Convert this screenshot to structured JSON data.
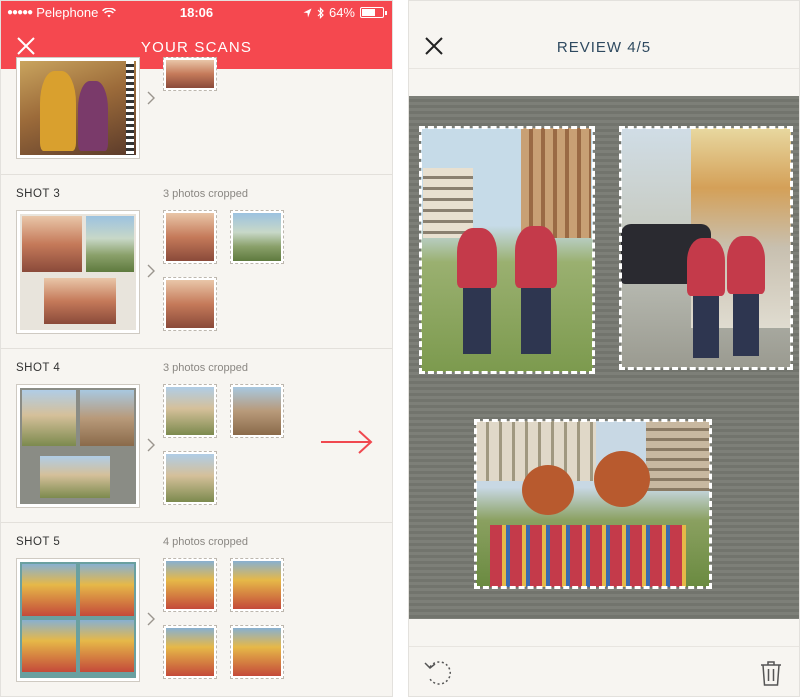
{
  "left_screen": {
    "status_bar": {
      "carrier": "Pelephone",
      "time": "18:06",
      "battery": "64%",
      "battery_level": 0.64
    },
    "header": {
      "title": "YOUR SCANS"
    },
    "shots": [
      {
        "label": "",
        "count": ""
      },
      {
        "label": "SHOT 3",
        "count": "3 photos cropped"
      },
      {
        "label": "SHOT 4",
        "count": "3 photos cropped"
      },
      {
        "label": "SHOT 5",
        "count": "4 photos cropped"
      }
    ]
  },
  "right_screen": {
    "header": {
      "title": "REVIEW 4/5"
    }
  },
  "icons": {
    "close": "close-icon",
    "chevron": "chevron-right-icon",
    "arrow": "arrow-right-icon",
    "rotate": "rotate-icon",
    "trash": "trash-icon",
    "wifi": "wifi-icon",
    "location": "location-icon",
    "bluetooth": "bluetooth-icon"
  },
  "colors": {
    "accent_red": "#f5484f",
    "review_title": "#2f4a60",
    "arrow": "#f0484f"
  }
}
